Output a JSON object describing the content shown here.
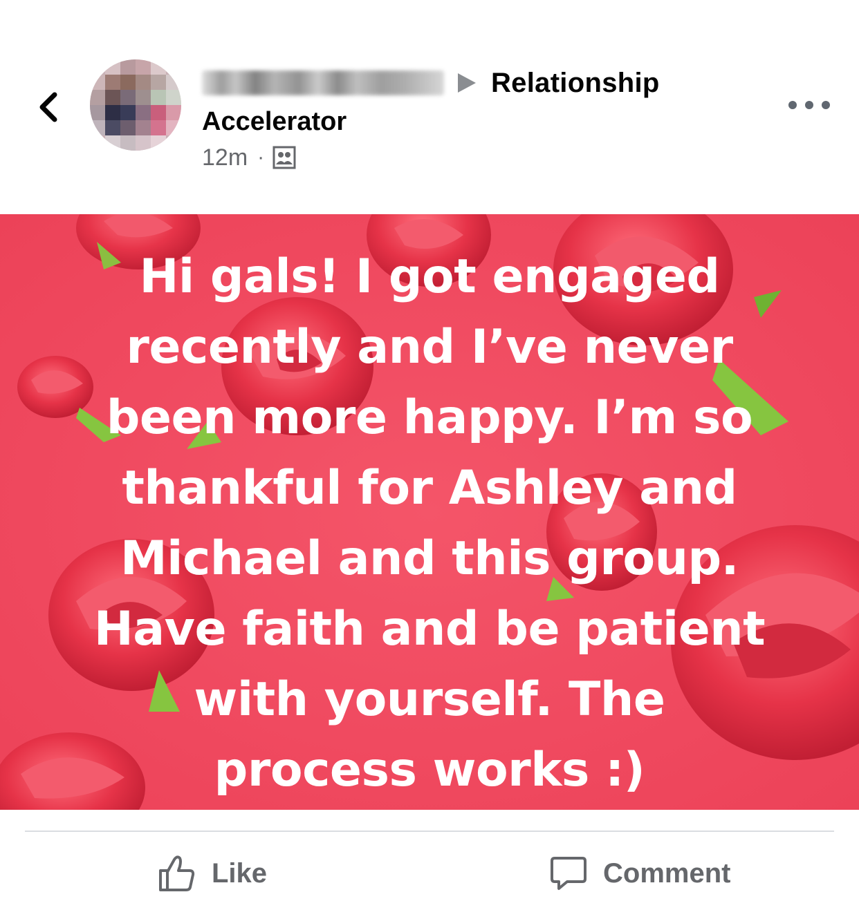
{
  "header": {
    "group_name_line1": "Relationship",
    "group_name_line2": "Accelerator",
    "time": "12m",
    "meta_separator": "·"
  },
  "icons": {
    "back": "chevron-left-icon",
    "more": "more-horizontal-icon",
    "privacy": "group-members-icon",
    "like": "thumbs-up-icon",
    "comment": "speech-bubble-icon"
  },
  "post": {
    "lines": [
      "Hi gals!  I got engaged",
      "recently and I’ve never",
      "been more happy.  I’m so",
      "thankful for Ashley and",
      "Michael and this group.",
      "Have faith and be patient",
      "with yourself.  The",
      "process works :)"
    ],
    "background_color": "#f04a60",
    "text_color": "#ffffff"
  },
  "actions": {
    "like_label": "Like",
    "comment_label": "Comment"
  }
}
